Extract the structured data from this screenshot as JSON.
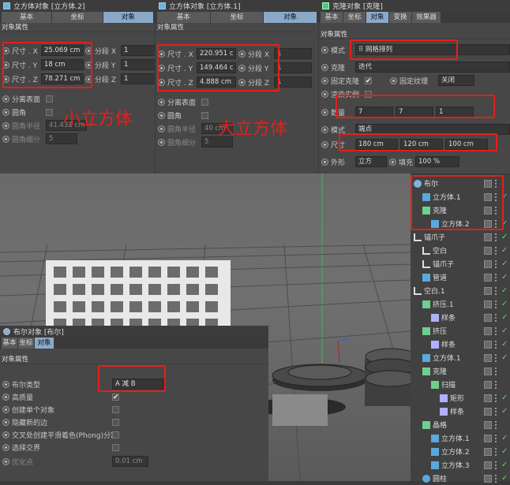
{
  "small_cube": {
    "title": "立方体对象 [立方体.2]",
    "tabs": [
      "基本",
      "坐标",
      "对象"
    ],
    "section": "对象属性",
    "size_x_label": "尺寸 . X",
    "size_x": "25.069 cm",
    "size_y_label": "尺寸 . Y",
    "size_y": "18 cm",
    "size_z_label": "尺寸 . Z",
    "size_z": "78.271 cm",
    "seg_x_label": "分段 X",
    "seg_x": "1",
    "seg_y_label": "分段 Y",
    "seg_y": "1",
    "seg_z_label": "分段 Z",
    "seg_z": "1",
    "sep_label": "分离表面",
    "fillet_label": "圆角",
    "fillet_radius_label": "圆角半径",
    "fillet_radius": "41.431 cm",
    "fillet_sub_label": "圆角细分",
    "fillet_sub": "5"
  },
  "big_cube": {
    "title": "立方体对象 [立方体.1]",
    "tabs": [
      "基本",
      "坐标",
      "对象"
    ],
    "section": "对象属性",
    "size_x_label": "尺寸 . X",
    "size_x": "220.951 c",
    "size_y_label": "尺寸 . Y",
    "size_y": "149.464 c",
    "size_z_label": "尺寸 . Z",
    "size_z": "4.888 cm",
    "seg_x_label": "分段 X",
    "seg_x": "1",
    "seg_y_label": "分段 Y",
    "seg_y": "1",
    "seg_z_label": "分段 Z",
    "seg_z": "1",
    "sep_label": "分离表面",
    "fillet_label": "圆角",
    "fillet_radius_label": "圆角半径",
    "fillet_radius": "40 cm",
    "fillet_sub_label": "圆角细分",
    "fillet_sub": "5"
  },
  "cloner": {
    "title": "克隆对象 [克隆]",
    "tabs": [
      "基本",
      "坐标",
      "对象",
      "变换",
      "效果器"
    ],
    "section": "对象属性",
    "mode_label": "模式",
    "mode": "网格排列",
    "clone_label": "克隆",
    "clone": "迭代",
    "fixed_clone_label": "固定克隆",
    "fixed_tex_label": "固定纹理",
    "fixed_tex": "关闭",
    "instance_label": "渲染实例",
    "count_label": "数量",
    "count_x": "7",
    "count_y": "7",
    "count_z": "1",
    "mode2_label": "模式",
    "mode2": "端点",
    "size_label": "尺寸",
    "size_x": "180 cm",
    "size_y": "120 cm",
    "size_z": "100 cm",
    "shape_label": "外形",
    "shape": "立方",
    "fill_label": "填充",
    "fill": "100 %"
  },
  "boole": {
    "title": "布尔对象 [布尔]",
    "tabs": [
      "基本",
      "坐标",
      "对象"
    ],
    "section": "对象属性",
    "type_label": "布尔类型",
    "type": "A 减 B",
    "hq_label": "高质量",
    "single_label": "创建单个对象",
    "hide_label": "隐藏新的边",
    "phong_label": "交叉处创建平滑着色(Phong)分割",
    "select_label": "选择交界",
    "opt_label": "优化点",
    "opt": "0.01 cm"
  },
  "annotations": {
    "small": "小立方体",
    "big": "大立方体"
  },
  "tree": [
    {
      "label": "布尔",
      "icon": "boole"
    },
    {
      "label": "立方体.1",
      "icon": "cube"
    },
    {
      "label": "克隆",
      "icon": "cloner"
    },
    {
      "label": "立方体.2",
      "icon": "cube"
    },
    {
      "label": "锚爪子",
      "icon": "null"
    },
    {
      "label": "空白",
      "icon": "null"
    },
    {
      "label": "锚爪子",
      "icon": "null"
    },
    {
      "label": "管道",
      "icon": "tube"
    },
    {
      "label": "空白.1",
      "icon": "null"
    },
    {
      "label": "挤压.1",
      "icon": "extrude"
    },
    {
      "label": "样条",
      "icon": "spline"
    },
    {
      "label": "挤压",
      "icon": "extrude"
    },
    {
      "label": "样条",
      "icon": "spline"
    },
    {
      "label": "立方体.1",
      "icon": "cube"
    },
    {
      "label": "克隆",
      "icon": "cloner"
    },
    {
      "label": "扫描",
      "icon": "sweep"
    },
    {
      "label": "矩形",
      "icon": "spline"
    },
    {
      "label": "样条",
      "icon": "spline"
    },
    {
      "label": "晶格",
      "icon": "lattice"
    },
    {
      "label": "立方体.1",
      "icon": "cube"
    },
    {
      "label": "立方体.2",
      "icon": "cube"
    },
    {
      "label": "立方体.3",
      "icon": "cube"
    },
    {
      "label": "圆柱",
      "icon": "cylinder"
    }
  ]
}
